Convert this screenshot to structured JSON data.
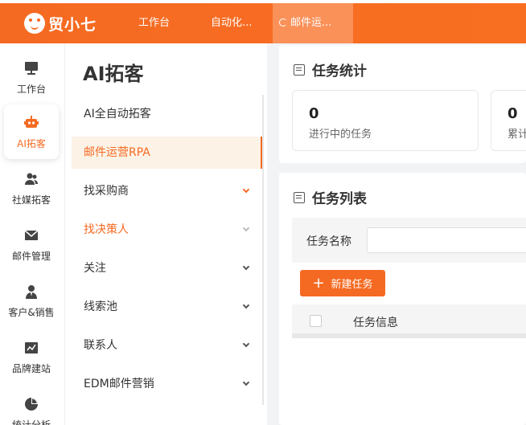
{
  "brand": {
    "name": "贸小七"
  },
  "topnav": [
    {
      "label": "工作台"
    },
    {
      "label": "自动化..."
    },
    {
      "label": "邮件运..."
    }
  ],
  "rail": [
    {
      "label": "工作台",
      "icon": "monitor-icon"
    },
    {
      "label": "AI拓客",
      "icon": "robot-icon"
    },
    {
      "label": "社媒拓客",
      "icon": "users-icon"
    },
    {
      "label": "邮件管理",
      "icon": "mail-icon"
    },
    {
      "label": "客户&销售",
      "icon": "person-icon"
    },
    {
      "label": "品牌建站",
      "icon": "chart-icon"
    },
    {
      "label": "统计分析",
      "icon": "pie-icon"
    }
  ],
  "submenu": {
    "title": "AI拓客",
    "items": [
      {
        "label": "AI全自动拓客"
      },
      {
        "label": "邮件运营RPA"
      },
      {
        "label": "找采购商"
      },
      {
        "label": "找决策人"
      },
      {
        "label": "关注"
      },
      {
        "label": "线索池"
      },
      {
        "label": "联系人"
      },
      {
        "label": "EDM邮件营销"
      }
    ]
  },
  "stats": {
    "title": "任务统计",
    "items": [
      {
        "value": "0",
        "label": "进行中的任务"
      },
      {
        "value": "0",
        "label": "累计"
      }
    ]
  },
  "tasks": {
    "title": "任务列表",
    "filter_label": "任务名称",
    "filter_value": "",
    "new_button": "新建任务",
    "columns": [
      "任务信息"
    ]
  },
  "colors": {
    "accent": "#f56a22",
    "accent_light": "#fdf2e6"
  }
}
